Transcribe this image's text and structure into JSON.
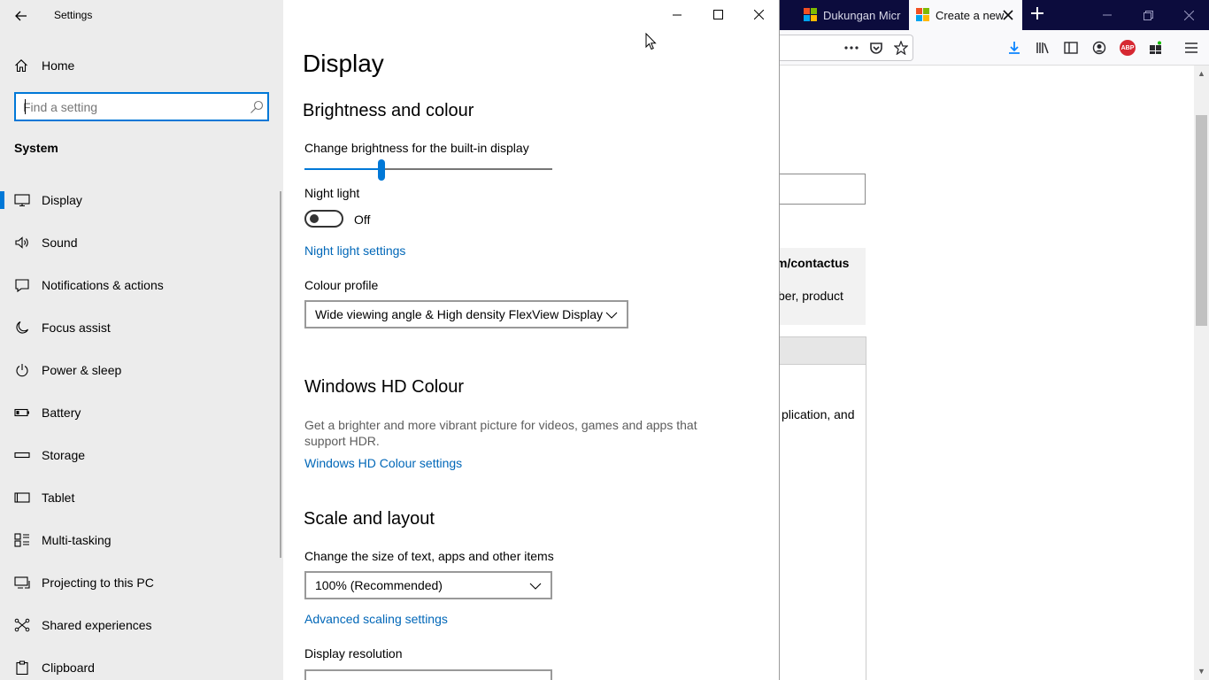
{
  "firefox": {
    "tabs": [
      {
        "title": "Dukungan Micr",
        "active": false
      },
      {
        "title": "Create a new",
        "active": true
      }
    ],
    "page_fragments": {
      "url_fragment": "m/contactus",
      "text_fragment_1": "ber, product",
      "text_fragment_2": "plication, and"
    },
    "colors": {
      "titlebar": "#0c0c3d",
      "toolbar": "#f9f9fb",
      "abp_badge": "#d62832"
    }
  },
  "settings": {
    "app_title": "Settings",
    "nav": {
      "home_label": "Home",
      "search_placeholder": "Find a setting",
      "section": "System",
      "items": [
        {
          "label": "Display",
          "icon": "monitor-icon",
          "active": true
        },
        {
          "label": "Sound",
          "icon": "speaker-icon",
          "active": false
        },
        {
          "label": "Notifications & actions",
          "icon": "notification-icon",
          "active": false
        },
        {
          "label": "Focus assist",
          "icon": "moon-icon",
          "active": false
        },
        {
          "label": "Power & sleep",
          "icon": "power-icon",
          "active": false
        },
        {
          "label": "Battery",
          "icon": "battery-icon",
          "active": false
        },
        {
          "label": "Storage",
          "icon": "storage-icon",
          "active": false
        },
        {
          "label": "Tablet",
          "icon": "tablet-icon",
          "active": false
        },
        {
          "label": "Multi-tasking",
          "icon": "multitasking-icon",
          "active": false
        },
        {
          "label": "Projecting to this PC",
          "icon": "projecting-icon",
          "active": false
        },
        {
          "label": "Shared experiences",
          "icon": "shared-experiences-icon",
          "active": false
        },
        {
          "label": "Clipboard",
          "icon": "clipboard-icon",
          "active": false
        }
      ]
    },
    "main": {
      "title": "Display",
      "brightness": {
        "heading": "Brightness and colour",
        "slider_label": "Change brightness for the built-in display",
        "brightness_value": 0.31
      },
      "night_light": {
        "label": "Night light",
        "state": "Off",
        "settings_link": "Night light settings"
      },
      "colour_profile": {
        "label": "Colour profile",
        "value": "Wide viewing angle & High density FlexView Display"
      },
      "hd_colour": {
        "heading": "Windows HD Colour",
        "description": "Get a brighter and more vibrant picture for videos, games and apps that support HDR.",
        "link": "Windows HD Colour settings"
      },
      "scale": {
        "heading": "Scale and layout",
        "size_label": "Change the size of text, apps and other items",
        "size_value": "100% (Recommended)",
        "advanced_link": "Advanced scaling settings",
        "resolution_label": "Display resolution"
      }
    },
    "colors": {
      "accent": "#0078d7",
      "link": "#0067b8",
      "nav_bg": "#ececec"
    }
  }
}
